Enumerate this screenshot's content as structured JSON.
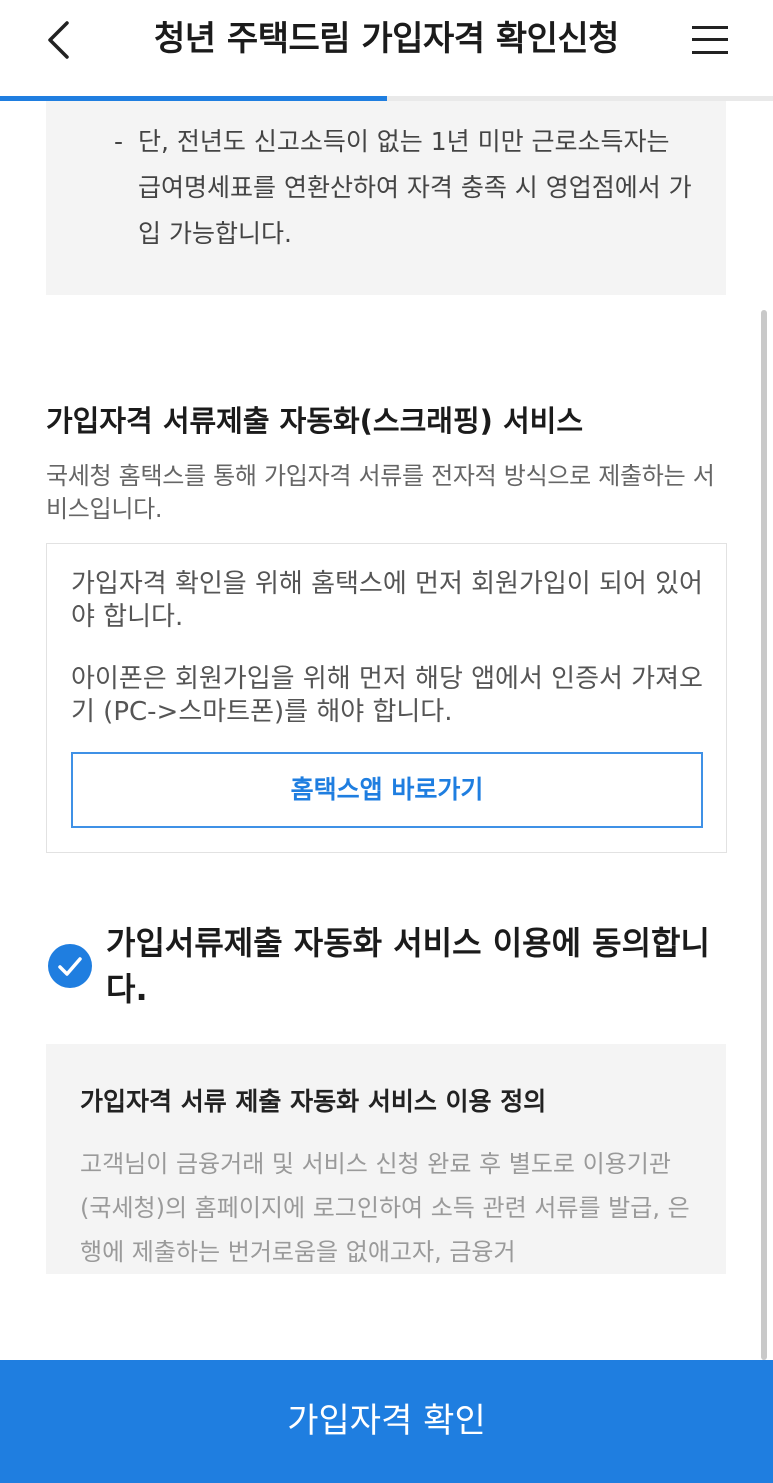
{
  "header": {
    "title": "청년 주택드림 가입자격 확인신청",
    "back_icon": "chevron-left-icon",
    "menu_icon": "hamburger-menu-icon",
    "progress_percent": 50
  },
  "notice": {
    "bullet": "-",
    "text": "단, 전년도 신고소득이 없는 1년 미만 근로소득자는 급여명세표를 연환산하여 자격 충족 시 영업점에서 가입 가능합니다."
  },
  "scraping": {
    "title": "가입자격 서류제출 자동화(스크래핑) 서비스",
    "description": "국세청 홈택스를 통해 가입자격 서류를 전자적 방식으로 제출하는 서비스입니다.",
    "info_1": "가입자격 확인을 위해 홈택스에 먼저 회원가입이 되어 있어야 합니다.",
    "info_2": "아이폰은 회원가입을 위해 먼저 해당 앱에서 인증서 가져오기 (PC->스마트폰)를 해야 합니다.",
    "hometax_button": "홈택스앱 바로가기"
  },
  "agreement": {
    "checked": true,
    "label": "가입서류제출 자동화 서비스 이용에 동의합니다."
  },
  "definition": {
    "title": "가입자격 서류 제출 자동화 서비스 이용 정의",
    "text": "고객님이 금융거래 및 서비스 신청 완료 후 별도로 이용기관(국세청)의 홈페이지에 로그인하여 소득 관련 서류를 발급, 은행에 제출하는 번거로움을 없애고자, 금융거"
  },
  "bottom_button": "가입자격 확인",
  "colors": {
    "accent": "#1f7ee0",
    "panel_bg": "#f4f4f4"
  }
}
